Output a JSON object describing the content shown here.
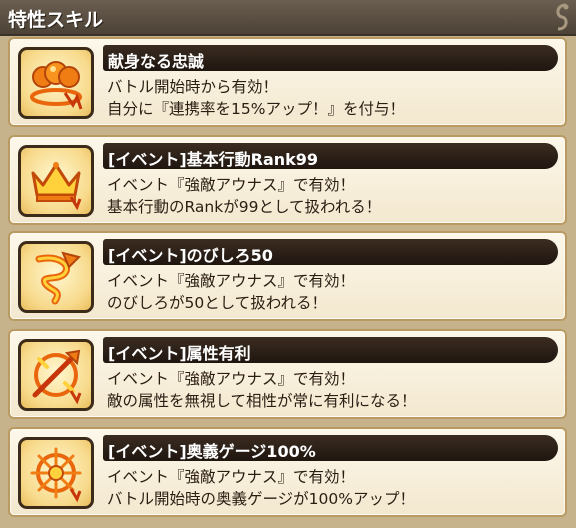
{
  "panel": {
    "title": "特性スキル"
  },
  "skills": [
    {
      "name": "献身なる忠誠",
      "icon": "loyalty-orbs-icon",
      "desc1": "バトル開始時から有効！",
      "desc2": "自分に『連携率を15%アップ！』を付与！"
    },
    {
      "name": "[イベント]基本行動Rank99",
      "icon": "crown-icon",
      "desc1": "イベント『強敵アウナス』で有効！",
      "desc2": "基本行動のRankが99として扱われる！"
    },
    {
      "name": "[イベント]のびしろ50",
      "icon": "growth-spiral-icon",
      "desc1": "イベント『強敵アウナス』で有効！",
      "desc2": "のびしろが50として扱われる！"
    },
    {
      "name": "[イベント]属性有利",
      "icon": "element-advantage-icon",
      "desc1": "イベント『強敵アウナス』で有効！",
      "desc2": "敵の属性を無視して相性が常に有利になる！"
    },
    {
      "name": "[イベント]奥義ゲージ100%",
      "icon": "ougi-gauge-icon",
      "desc1": "イベント『強敵アウナス』で有効！",
      "desc2": "バトル開始時の奥義ゲージが100%アップ！"
    }
  ],
  "colors": {
    "header_bg": "#55493d",
    "card_bg": "#f8f0dc",
    "name_bar_bg": "#2a1e15",
    "icon_orange": "#f07d14",
    "icon_yellow": "#ffd23c"
  }
}
